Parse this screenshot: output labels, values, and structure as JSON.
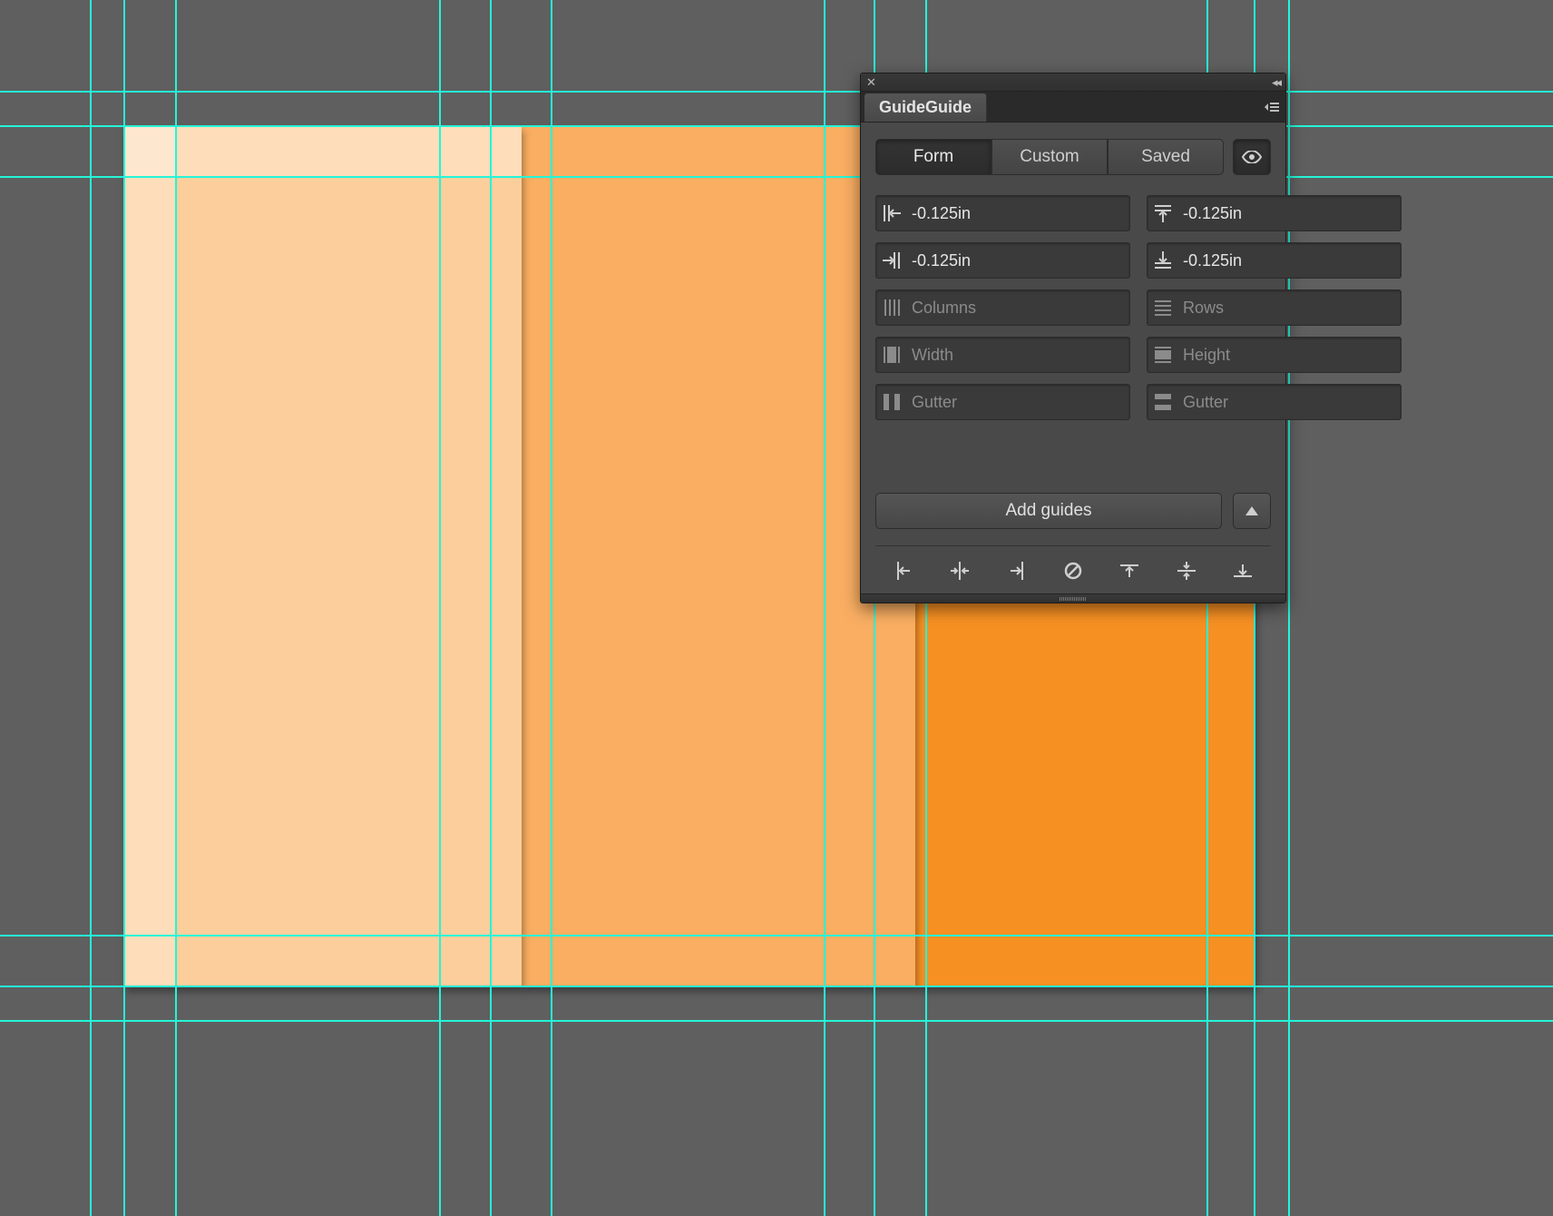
{
  "panel": {
    "title": "GuideGuide",
    "tabs": {
      "form": "Form",
      "custom": "Custom",
      "saved": "Saved"
    },
    "fields": {
      "margin_left": "-0.125in",
      "margin_right": "-0.125in",
      "margin_top": "-0.125in",
      "margin_bottom": "-0.125in",
      "columns_placeholder": "Columns",
      "rows_placeholder": "Rows",
      "width_placeholder": "Width",
      "height_placeholder": "Height",
      "col_gutter_placeholder": "Gutter",
      "row_gutter_placeholder": "Gutter"
    },
    "add_button": "Add guides"
  },
  "colors": {
    "guide": "#24f5d8",
    "canvas_bg": "#5f5f5f",
    "panel_bg": "#494949",
    "art_light": "#fcce9c",
    "art_mid": "#f9ae62",
    "art_dark": "#f79023"
  }
}
